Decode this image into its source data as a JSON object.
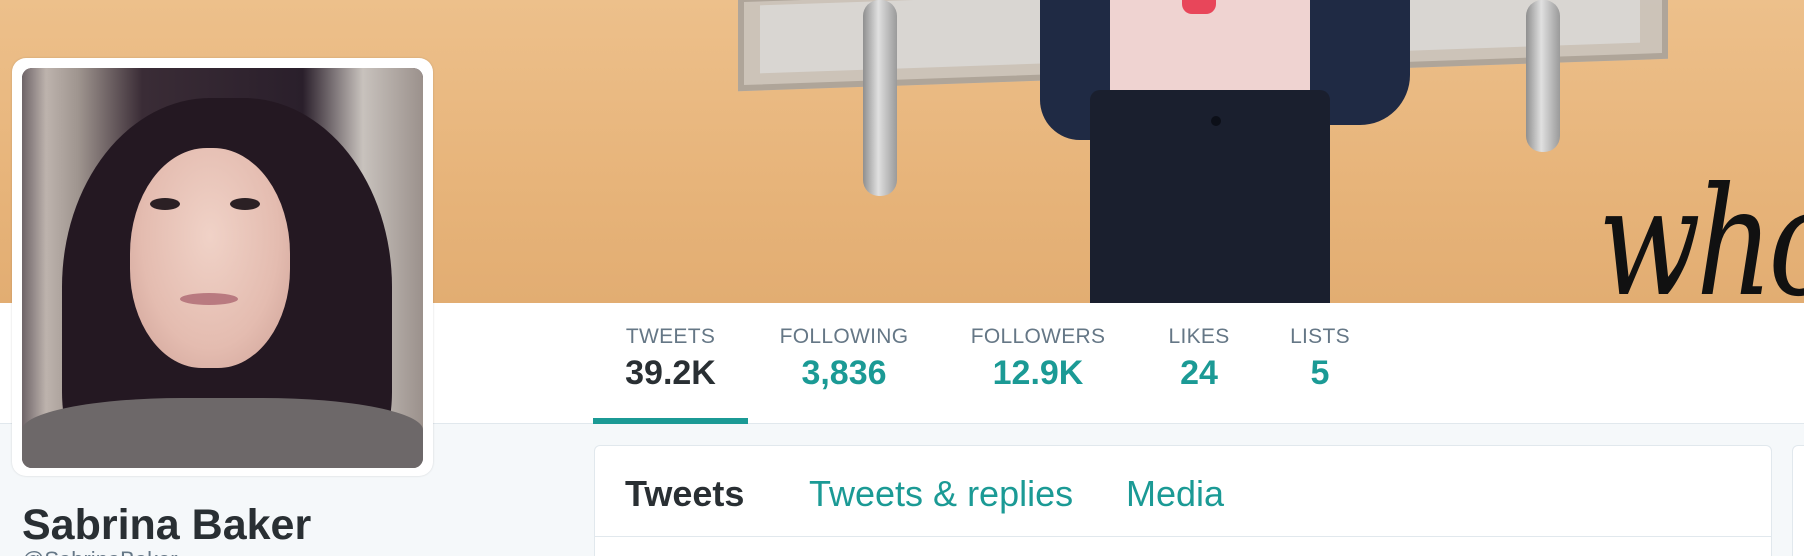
{
  "profile": {
    "name": "Sabrina Baker",
    "handle": "@SabrinaBaker"
  },
  "stats": [
    {
      "label": "TWEETS",
      "value": "39.2K",
      "active": true
    },
    {
      "label": "FOLLOWING",
      "value": "3,836",
      "active": false
    },
    {
      "label": "FOLLOWERS",
      "value": "12.9K",
      "active": false
    },
    {
      "label": "LIKES",
      "value": "24",
      "active": false
    },
    {
      "label": "LISTS",
      "value": "5",
      "active": false
    }
  ],
  "timeline_tabs": [
    {
      "label": "Tweets",
      "active": true
    },
    {
      "label": "Tweets & replies",
      "active": false
    },
    {
      "label": "Media",
      "active": false
    }
  ],
  "banner": {
    "scrawl_text": "who"
  },
  "colors": {
    "accent": "#1b9a95",
    "text_primary": "#292f33",
    "text_secondary": "#657786",
    "background": "#f5f8fa"
  }
}
